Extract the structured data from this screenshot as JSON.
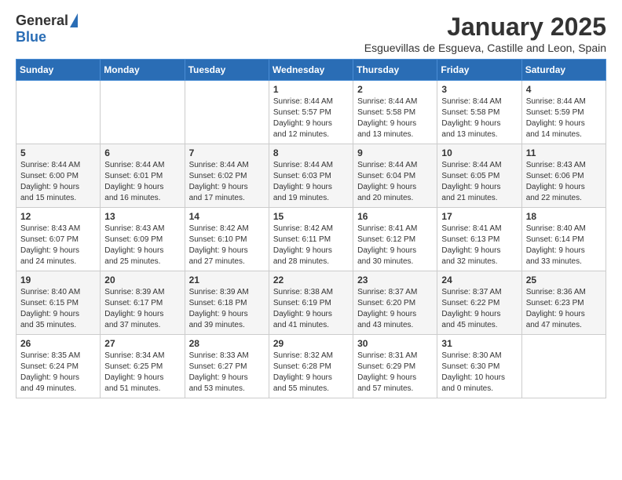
{
  "logo": {
    "general": "General",
    "blue": "Blue"
  },
  "header": {
    "month_title": "January 2025",
    "subtitle": "Esguevillas de Esgueva, Castille and Leon, Spain"
  },
  "weekdays": [
    "Sunday",
    "Monday",
    "Tuesday",
    "Wednesday",
    "Thursday",
    "Friday",
    "Saturday"
  ],
  "weeks": [
    [
      {
        "day": "",
        "info": ""
      },
      {
        "day": "",
        "info": ""
      },
      {
        "day": "",
        "info": ""
      },
      {
        "day": "1",
        "info": "Sunrise: 8:44 AM\nSunset: 5:57 PM\nDaylight: 9 hours\nand 12 minutes."
      },
      {
        "day": "2",
        "info": "Sunrise: 8:44 AM\nSunset: 5:58 PM\nDaylight: 9 hours\nand 13 minutes."
      },
      {
        "day": "3",
        "info": "Sunrise: 8:44 AM\nSunset: 5:58 PM\nDaylight: 9 hours\nand 13 minutes."
      },
      {
        "day": "4",
        "info": "Sunrise: 8:44 AM\nSunset: 5:59 PM\nDaylight: 9 hours\nand 14 minutes."
      }
    ],
    [
      {
        "day": "5",
        "info": "Sunrise: 8:44 AM\nSunset: 6:00 PM\nDaylight: 9 hours\nand 15 minutes."
      },
      {
        "day": "6",
        "info": "Sunrise: 8:44 AM\nSunset: 6:01 PM\nDaylight: 9 hours\nand 16 minutes."
      },
      {
        "day": "7",
        "info": "Sunrise: 8:44 AM\nSunset: 6:02 PM\nDaylight: 9 hours\nand 17 minutes."
      },
      {
        "day": "8",
        "info": "Sunrise: 8:44 AM\nSunset: 6:03 PM\nDaylight: 9 hours\nand 19 minutes."
      },
      {
        "day": "9",
        "info": "Sunrise: 8:44 AM\nSunset: 6:04 PM\nDaylight: 9 hours\nand 20 minutes."
      },
      {
        "day": "10",
        "info": "Sunrise: 8:44 AM\nSunset: 6:05 PM\nDaylight: 9 hours\nand 21 minutes."
      },
      {
        "day": "11",
        "info": "Sunrise: 8:43 AM\nSunset: 6:06 PM\nDaylight: 9 hours\nand 22 minutes."
      }
    ],
    [
      {
        "day": "12",
        "info": "Sunrise: 8:43 AM\nSunset: 6:07 PM\nDaylight: 9 hours\nand 24 minutes."
      },
      {
        "day": "13",
        "info": "Sunrise: 8:43 AM\nSunset: 6:09 PM\nDaylight: 9 hours\nand 25 minutes."
      },
      {
        "day": "14",
        "info": "Sunrise: 8:42 AM\nSunset: 6:10 PM\nDaylight: 9 hours\nand 27 minutes."
      },
      {
        "day": "15",
        "info": "Sunrise: 8:42 AM\nSunset: 6:11 PM\nDaylight: 9 hours\nand 28 minutes."
      },
      {
        "day": "16",
        "info": "Sunrise: 8:41 AM\nSunset: 6:12 PM\nDaylight: 9 hours\nand 30 minutes."
      },
      {
        "day": "17",
        "info": "Sunrise: 8:41 AM\nSunset: 6:13 PM\nDaylight: 9 hours\nand 32 minutes."
      },
      {
        "day": "18",
        "info": "Sunrise: 8:40 AM\nSunset: 6:14 PM\nDaylight: 9 hours\nand 33 minutes."
      }
    ],
    [
      {
        "day": "19",
        "info": "Sunrise: 8:40 AM\nSunset: 6:15 PM\nDaylight: 9 hours\nand 35 minutes."
      },
      {
        "day": "20",
        "info": "Sunrise: 8:39 AM\nSunset: 6:17 PM\nDaylight: 9 hours\nand 37 minutes."
      },
      {
        "day": "21",
        "info": "Sunrise: 8:39 AM\nSunset: 6:18 PM\nDaylight: 9 hours\nand 39 minutes."
      },
      {
        "day": "22",
        "info": "Sunrise: 8:38 AM\nSunset: 6:19 PM\nDaylight: 9 hours\nand 41 minutes."
      },
      {
        "day": "23",
        "info": "Sunrise: 8:37 AM\nSunset: 6:20 PM\nDaylight: 9 hours\nand 43 minutes."
      },
      {
        "day": "24",
        "info": "Sunrise: 8:37 AM\nSunset: 6:22 PM\nDaylight: 9 hours\nand 45 minutes."
      },
      {
        "day": "25",
        "info": "Sunrise: 8:36 AM\nSunset: 6:23 PM\nDaylight: 9 hours\nand 47 minutes."
      }
    ],
    [
      {
        "day": "26",
        "info": "Sunrise: 8:35 AM\nSunset: 6:24 PM\nDaylight: 9 hours\nand 49 minutes."
      },
      {
        "day": "27",
        "info": "Sunrise: 8:34 AM\nSunset: 6:25 PM\nDaylight: 9 hours\nand 51 minutes."
      },
      {
        "day": "28",
        "info": "Sunrise: 8:33 AM\nSunset: 6:27 PM\nDaylight: 9 hours\nand 53 minutes."
      },
      {
        "day": "29",
        "info": "Sunrise: 8:32 AM\nSunset: 6:28 PM\nDaylight: 9 hours\nand 55 minutes."
      },
      {
        "day": "30",
        "info": "Sunrise: 8:31 AM\nSunset: 6:29 PM\nDaylight: 9 hours\nand 57 minutes."
      },
      {
        "day": "31",
        "info": "Sunrise: 8:30 AM\nSunset: 6:30 PM\nDaylight: 10 hours\nand 0 minutes."
      },
      {
        "day": "",
        "info": ""
      }
    ]
  ]
}
